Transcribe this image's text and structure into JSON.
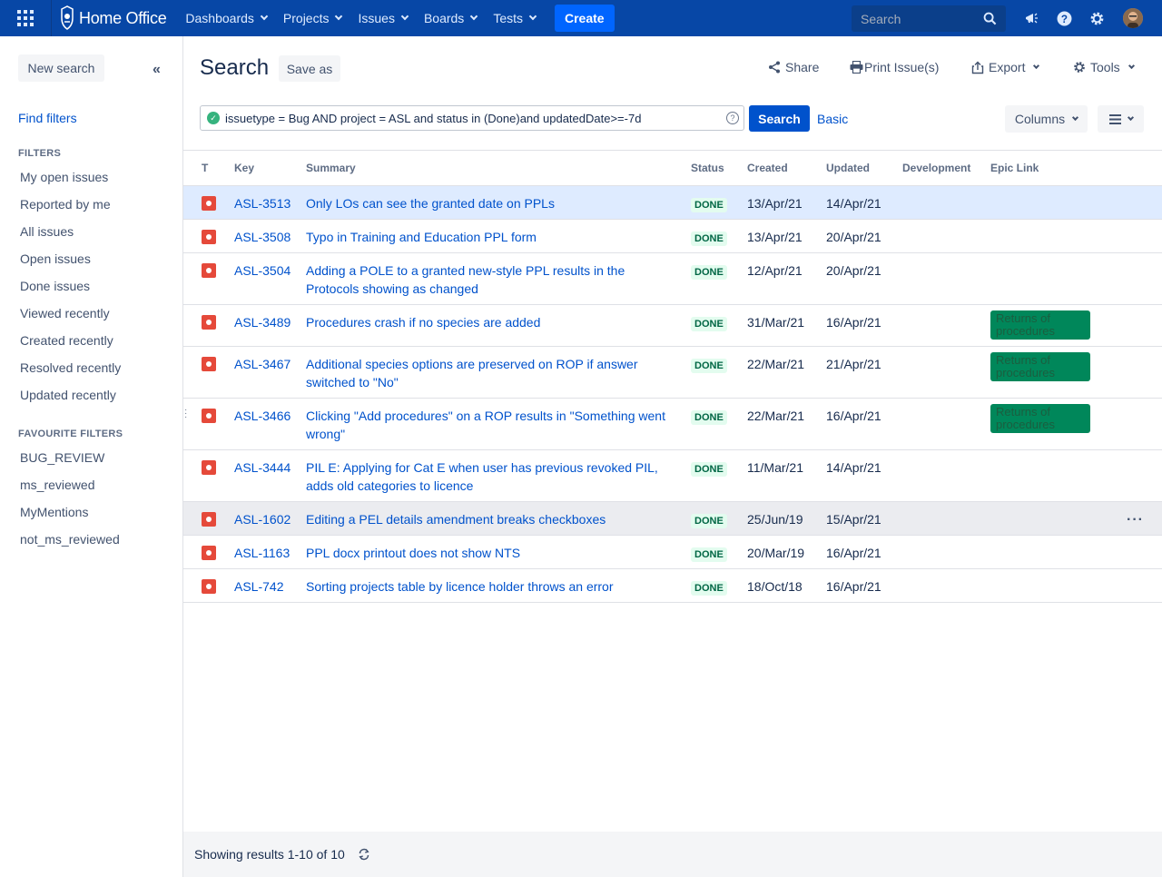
{
  "topnav": {
    "logo": "Home Office",
    "items": [
      {
        "label": "Dashboards"
      },
      {
        "label": "Projects"
      },
      {
        "label": "Issues"
      },
      {
        "label": "Boards"
      },
      {
        "label": "Tests"
      }
    ],
    "create_label": "Create",
    "search_placeholder": "Search",
    "icons": [
      "app-switcher-icon",
      "notifications-icon",
      "help-icon",
      "settings-icon",
      "avatar"
    ]
  },
  "sidebar": {
    "new_search_label": "New search",
    "find_filters_label": "Find filters",
    "filters_heading": "FILTERS",
    "filters": [
      "My open issues",
      "Reported by me",
      "All issues",
      "Open issues",
      "Done issues",
      "Viewed recently",
      "Created recently",
      "Resolved recently",
      "Updated recently"
    ],
    "favourites_heading": "FAVOURITE FILTERS",
    "favourites": [
      "BUG_REVIEW",
      "ms_reviewed",
      "MyMentions",
      "not_ms_reviewed"
    ]
  },
  "header": {
    "title": "Search",
    "save_as_label": "Save as",
    "share_label": "Share",
    "print_label": "Print Issue(s)",
    "export_label": "Export",
    "tools_label": "Tools"
  },
  "query": {
    "jql": "issuetype = Bug AND project = ASL and status in (Done)and updatedDate>=-7d",
    "search_label": "Search",
    "basic_label": "Basic",
    "columns_label": "Columns"
  },
  "table": {
    "columns": [
      "T",
      "Key",
      "Summary",
      "Status",
      "Created",
      "Updated",
      "Development",
      "Epic Link"
    ],
    "rows": [
      {
        "key": "ASL-3513",
        "summary": "Only LOs can see the granted date on PPLs",
        "status": "DONE",
        "created": "13/Apr/21",
        "updated": "14/Apr/21",
        "epic": ""
      },
      {
        "key": "ASL-3508",
        "summary": "Typo in Training and Education PPL form",
        "status": "DONE",
        "created": "13/Apr/21",
        "updated": "20/Apr/21",
        "epic": ""
      },
      {
        "key": "ASL-3504",
        "summary": "Adding a POLE to a granted new-style PPL results in the Protocols showing as changed",
        "status": "DONE",
        "created": "12/Apr/21",
        "updated": "20/Apr/21",
        "epic": ""
      },
      {
        "key": "ASL-3489",
        "summary": "Procedures crash if no species are added",
        "status": "DONE",
        "created": "31/Mar/21",
        "updated": "16/Apr/21",
        "epic": "Returns of procedures"
      },
      {
        "key": "ASL-3467",
        "summary": "Additional species options are preserved on ROP if answer switched to \"No\"",
        "status": "DONE",
        "created": "22/Mar/21",
        "updated": "21/Apr/21",
        "epic": "Returns of procedures"
      },
      {
        "key": "ASL-3466",
        "summary": "Clicking \"Add procedures\" on a ROP results in \"Something went wrong\"",
        "status": "DONE",
        "created": "22/Mar/21",
        "updated": "16/Apr/21",
        "epic": "Returns of procedures"
      },
      {
        "key": "ASL-3444",
        "summary": "PIL E: Applying for Cat E when user has previous revoked PIL, adds old categories to licence",
        "status": "DONE",
        "created": "11/Mar/21",
        "updated": "14/Apr/21",
        "epic": ""
      },
      {
        "key": "ASL-1602",
        "summary": "Editing a PEL details amendment breaks checkboxes",
        "status": "DONE",
        "created": "25/Jun/19",
        "updated": "15/Apr/21",
        "epic": ""
      },
      {
        "key": "ASL-1163",
        "summary": "PPL docx printout does not show NTS",
        "status": "DONE",
        "created": "20/Mar/19",
        "updated": "16/Apr/21",
        "epic": ""
      },
      {
        "key": "ASL-742",
        "summary": "Sorting projects table by licence holder throws an error",
        "status": "DONE",
        "created": "18/Oct/18",
        "updated": "16/Apr/21",
        "epic": ""
      }
    ]
  },
  "footer": {
    "results_text": "Showing results 1-10 of 10"
  },
  "colors": {
    "nav_bg": "#0747a6",
    "primary": "#0052cc",
    "create": "#0065ff",
    "bug": "#e5493a",
    "done_bg": "#e3fcef",
    "done_text": "#006644",
    "epic_bg": "#00875a",
    "selected_row": "#deebff"
  }
}
